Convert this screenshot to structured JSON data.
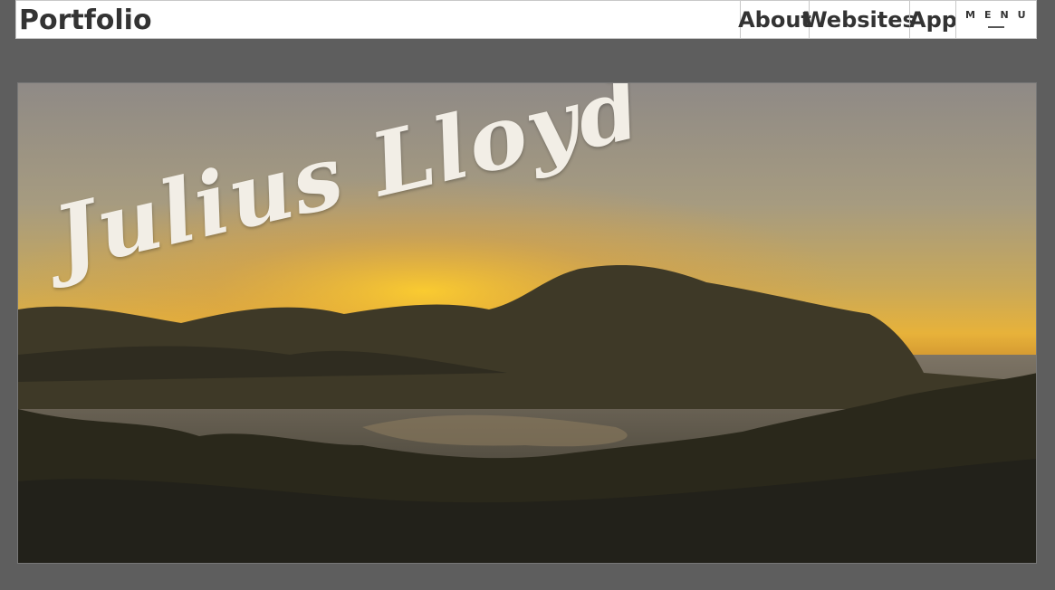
{
  "header": {
    "brand": "Portfolio",
    "nav": {
      "about": "About",
      "websites": "Websites",
      "app": "App",
      "menu": "MENU"
    }
  },
  "hero": {
    "title": "Julius Lloyd",
    "image": "sunset-over-island-bay-photo"
  }
}
